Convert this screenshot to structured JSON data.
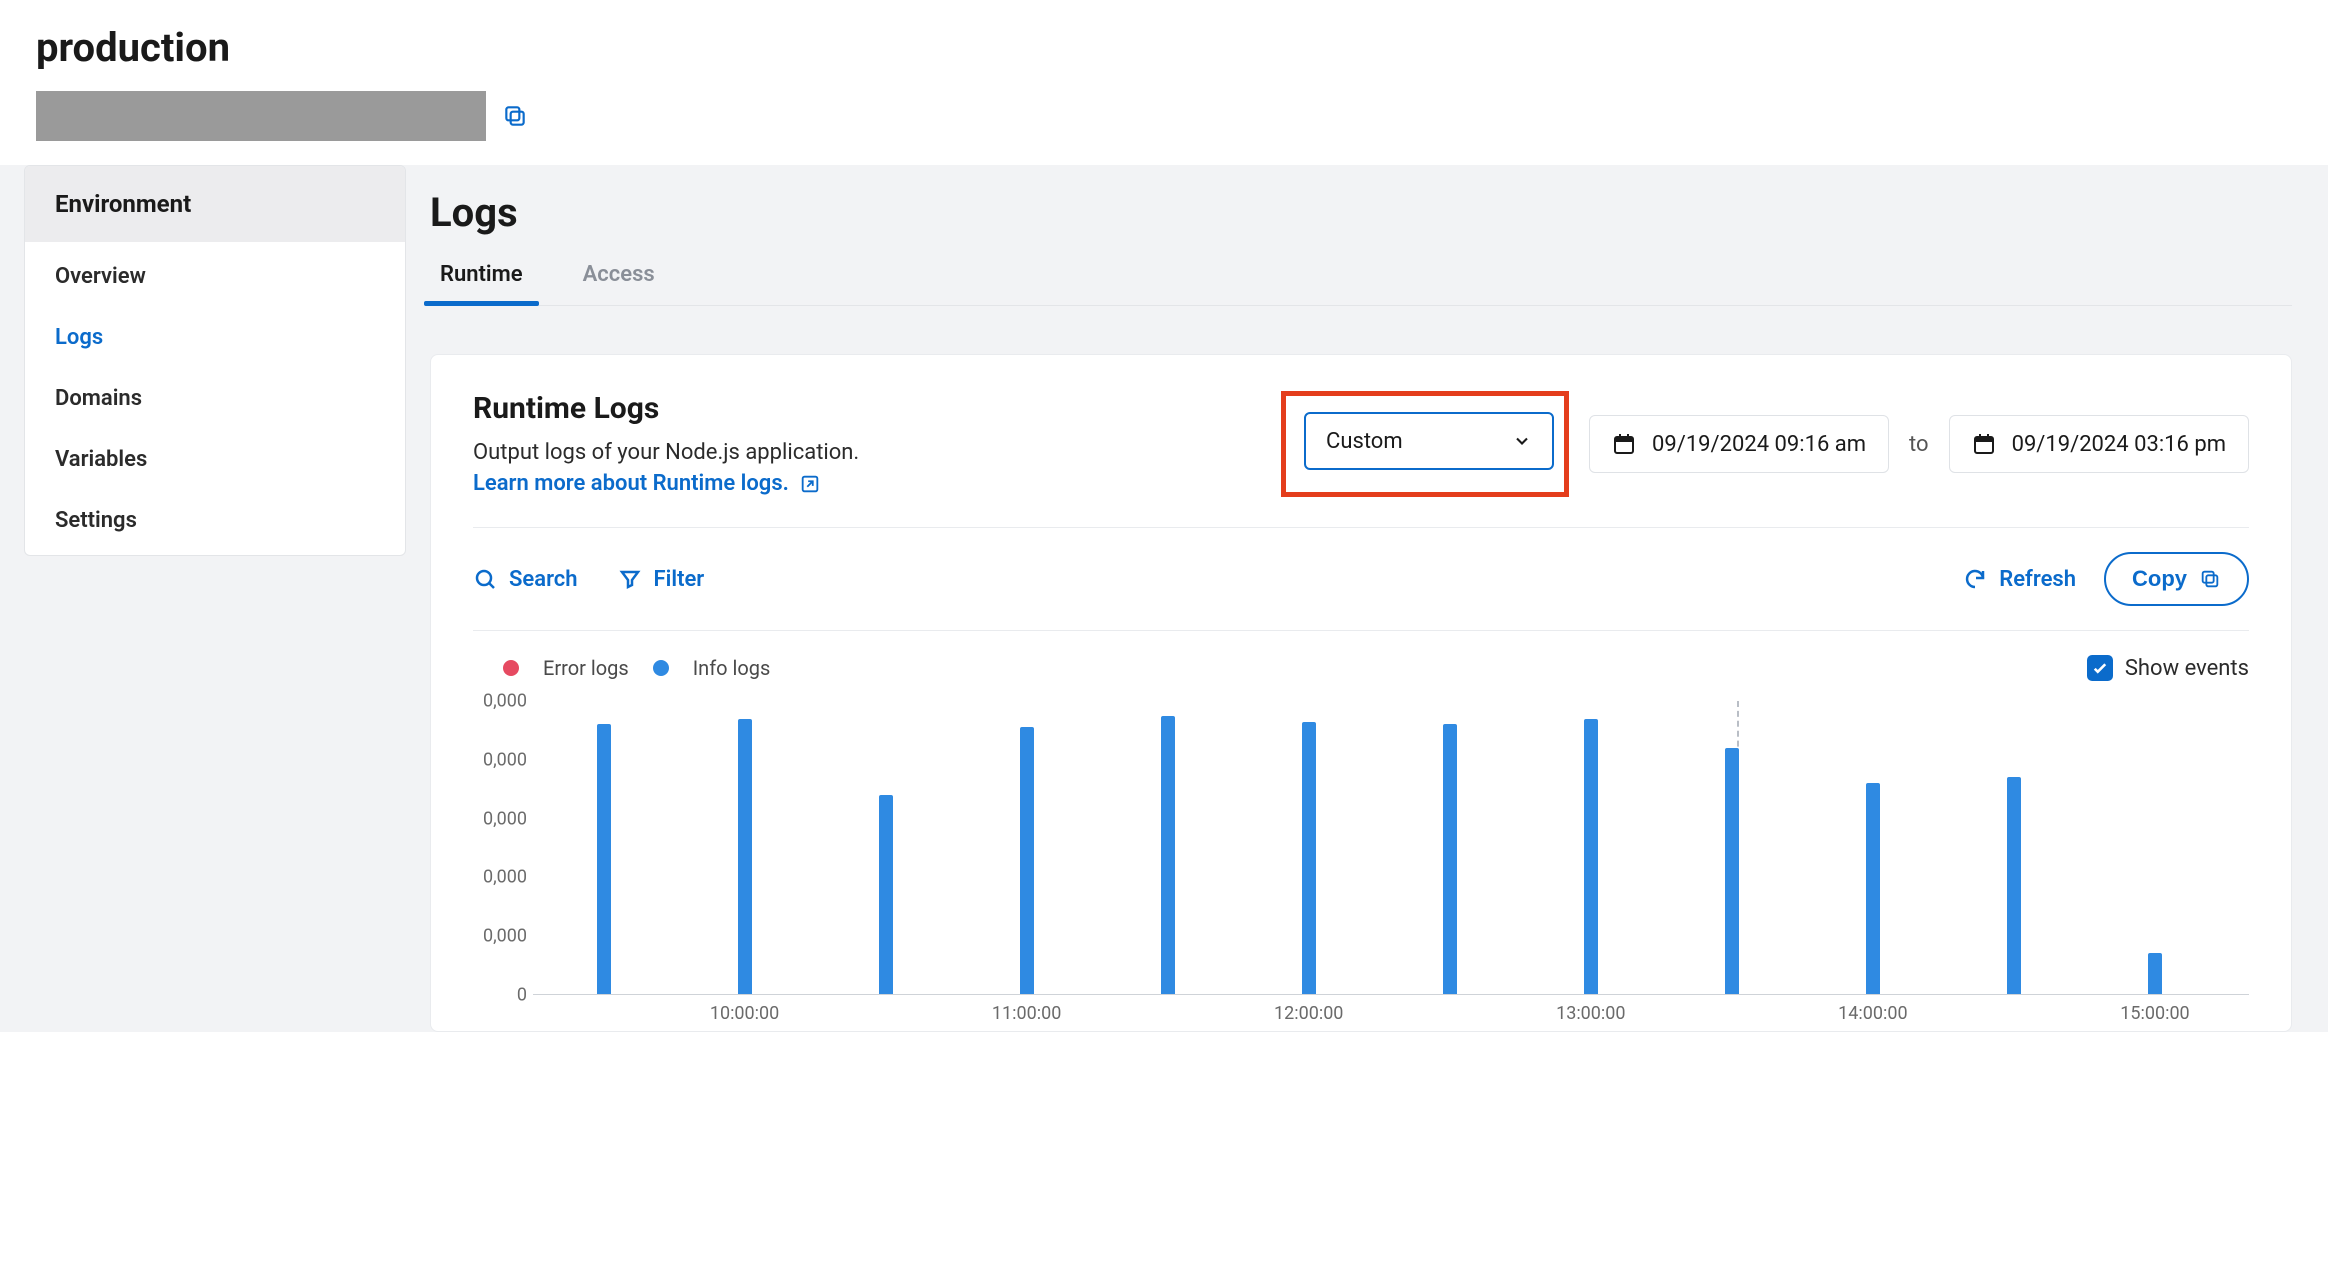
{
  "header": {
    "title": "production"
  },
  "sidebar": {
    "heading": "Environment",
    "items": [
      {
        "label": "Overview",
        "active": false
      },
      {
        "label": "Logs",
        "active": true
      },
      {
        "label": "Domains",
        "active": false
      },
      {
        "label": "Variables",
        "active": false
      },
      {
        "label": "Settings",
        "active": false
      }
    ]
  },
  "main": {
    "title": "Logs",
    "tabs": [
      {
        "label": "Runtime",
        "active": true
      },
      {
        "label": "Access",
        "active": false
      }
    ]
  },
  "panel": {
    "title": "Runtime Logs",
    "description": "Output logs of your Node.js application.",
    "link_text": "Learn more about Runtime logs.",
    "range_select": "Custom",
    "from_date": "09/19/2024 09:16 am",
    "to_label": "to",
    "to_date": "09/19/2024 03:16 pm",
    "toolbar": {
      "search": "Search",
      "filter": "Filter",
      "refresh": "Refresh",
      "copy": "Copy"
    },
    "legend": {
      "error": "Error logs",
      "info": "Info logs",
      "show_events": "Show events"
    }
  },
  "chart_data": {
    "type": "bar",
    "title": "",
    "xlabel": "",
    "ylabel": "",
    "ylim": [
      0,
      100000
    ],
    "y_ticks": [
      "0,000",
      "0,000",
      "0,000",
      "0,000",
      "0,000",
      "0"
    ],
    "x_ticks": [
      "10:00:00",
      "11:00:00",
      "12:00:00",
      "13:00:00",
      "14:00:00",
      "15:00:00"
    ],
    "x_domain_minutes": [
      555,
      920
    ],
    "x_tick_minutes": [
      600,
      660,
      720,
      780,
      840,
      900
    ],
    "series": [
      {
        "name": "Info logs",
        "color": "#2f8ae2",
        "x_minutes": [
          570,
          600,
          630,
          660,
          690,
          720,
          750,
          780,
          810,
          840,
          870,
          900
        ],
        "values": [
          92000,
          94000,
          68000,
          91000,
          95000,
          93000,
          92000,
          94000,
          84000,
          72000,
          74000,
          14000
        ]
      },
      {
        "name": "Error logs",
        "color": "#e64a61",
        "x_minutes": [],
        "values": []
      }
    ],
    "event_line_minute": 811
  }
}
